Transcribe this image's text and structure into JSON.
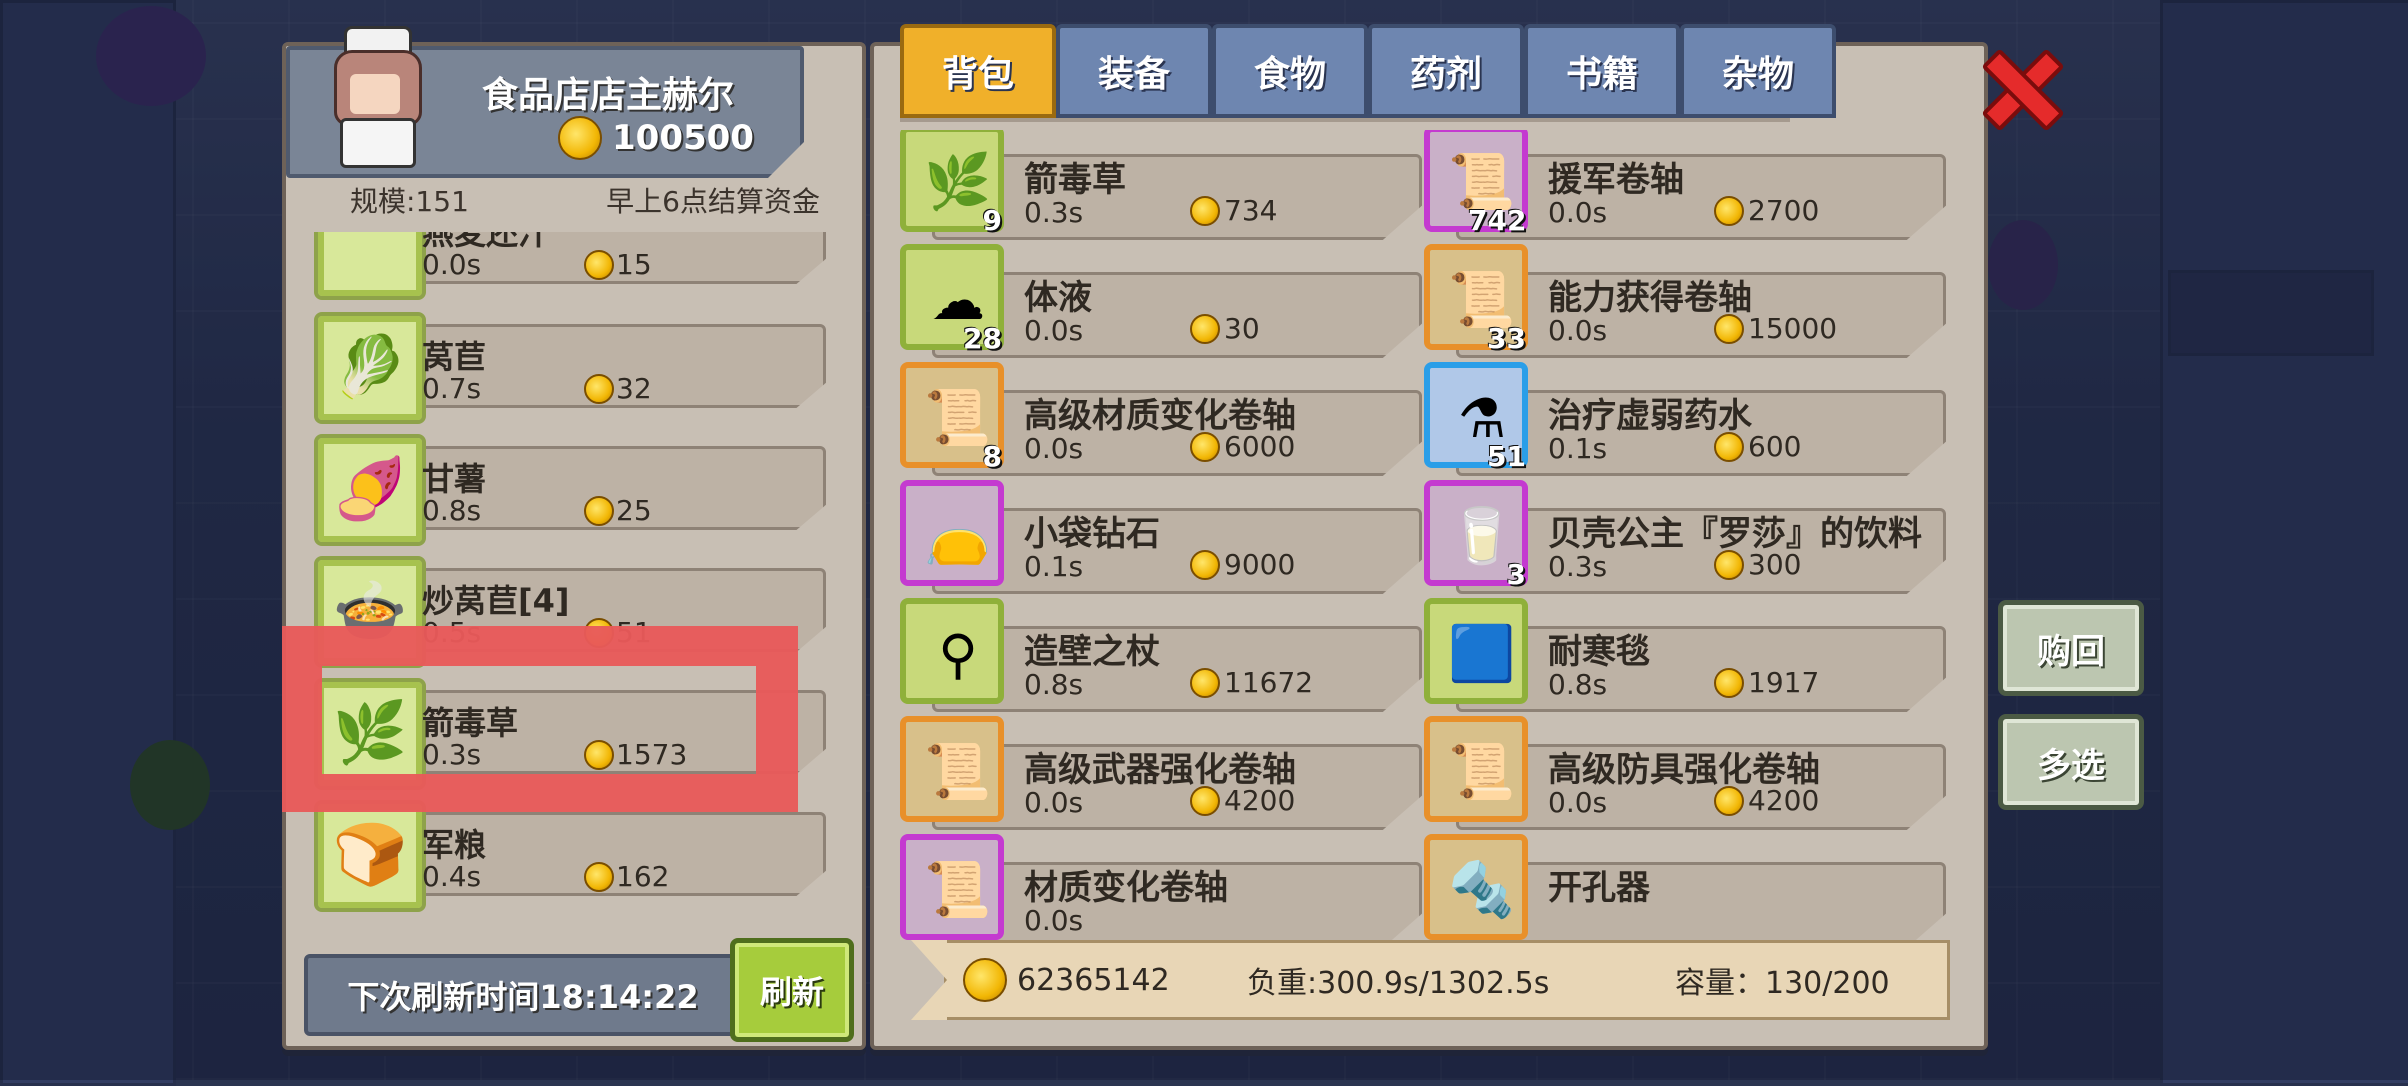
{
  "shop": {
    "merchant_name": "食品店店主赫尔",
    "merchant_money": "100500",
    "scale": "规模:151",
    "settle": "早上6点结算资金",
    "items": [
      {
        "name": "燕麦还汁",
        "time": "0.0s",
        "price": "15",
        "icon": "food-icon"
      },
      {
        "name": "莴苣",
        "time": "0.7s",
        "price": "32",
        "icon": "lettuce-icon"
      },
      {
        "name": "甘薯",
        "time": "0.8s",
        "price": "25",
        "icon": "sweet-potato-icon"
      },
      {
        "name": "炒莴苣[4]",
        "time": "0.5s",
        "price": "51",
        "icon": "fried-lettuce-icon"
      },
      {
        "name": "箭毒草",
        "time": "0.3s",
        "price": "1573",
        "icon": "herb-icon"
      },
      {
        "name": "军粮",
        "time": "0.4s",
        "price": "162",
        "icon": "ration-icon"
      }
    ],
    "refresh_time": "下次刷新时间18:14:22",
    "refresh_label": "刷新"
  },
  "inventory": {
    "tabs": [
      "背包",
      "装备",
      "食物",
      "药剂",
      "书籍",
      "杂物"
    ],
    "active_tab": "背包",
    "items": [
      {
        "name": "箭毒草",
        "qty": "9",
        "time": "0.3s",
        "price": "734",
        "frame": "g",
        "glyph": "🌿",
        "icon": "herb-icon"
      },
      {
        "name": "援军卷轴",
        "qty": "742",
        "time": "0.0s",
        "price": "2700",
        "frame": "p",
        "glyph": "📜",
        "icon": "scroll-red-icon"
      },
      {
        "name": "体液",
        "qty": "28",
        "time": "0.0s",
        "price": "30",
        "frame": "g",
        "glyph": "☁",
        "icon": "fluid-icon"
      },
      {
        "name": "能力获得卷轴",
        "qty": "33",
        "time": "0.0s",
        "price": "15000",
        "frame": "o",
        "glyph": "📜",
        "icon": "scroll-blue-icon"
      },
      {
        "name": "高级材质变化卷轴",
        "qty": "8",
        "time": "0.0s",
        "price": "6000",
        "frame": "o",
        "glyph": "📜",
        "icon": "scroll-red-icon"
      },
      {
        "name": "治疗虚弱药水",
        "qty": "51",
        "time": "0.1s",
        "price": "600",
        "frame": "b",
        "glyph": "⚗",
        "icon": "potion-icon"
      },
      {
        "name": "小袋钻石",
        "qty": "",
        "time": "0.1s",
        "price": "9000",
        "frame": "p",
        "glyph": "👝",
        "icon": "diamond-bag-icon"
      },
      {
        "name": "贝壳公主『罗莎』的饮料",
        "qty": "3",
        "time": "0.3s",
        "price": "300",
        "frame": "p",
        "glyph": "🥛",
        "icon": "drink-bottle-icon"
      },
      {
        "name": "造壁之杖",
        "qty": "",
        "time": "0.8s",
        "price": "11672",
        "frame": "g",
        "glyph": "⚲",
        "icon": "staff-icon"
      },
      {
        "name": "耐寒毯",
        "qty": "",
        "time": "0.8s",
        "price": "1917",
        "frame": "g",
        "glyph": "🟦",
        "icon": "blanket-icon"
      },
      {
        "name": "高级武器强化卷轴",
        "qty": "",
        "time": "0.0s",
        "price": "4200",
        "frame": "o",
        "glyph": "📜",
        "icon": "scroll-green-icon"
      },
      {
        "name": "高级防具强化卷轴",
        "qty": "",
        "time": "0.0s",
        "price": "4200",
        "frame": "o",
        "glyph": "📜",
        "icon": "scroll-green-icon"
      },
      {
        "name": "材质变化卷轴",
        "qty": "",
        "time": "0.0s",
        "price": "",
        "frame": "p",
        "glyph": "📜",
        "icon": "scroll-brown-icon"
      },
      {
        "name": "开孔器",
        "qty": "",
        "time": "",
        "price": "",
        "frame": "o",
        "glyph": "🔩",
        "icon": "drill-icon"
      }
    ],
    "gold": "62365142",
    "load": "负重:300.9s/1302.5s",
    "capacity": "容量：130/200"
  },
  "buttons": {
    "buyback": "购回",
    "multi": "多选"
  }
}
